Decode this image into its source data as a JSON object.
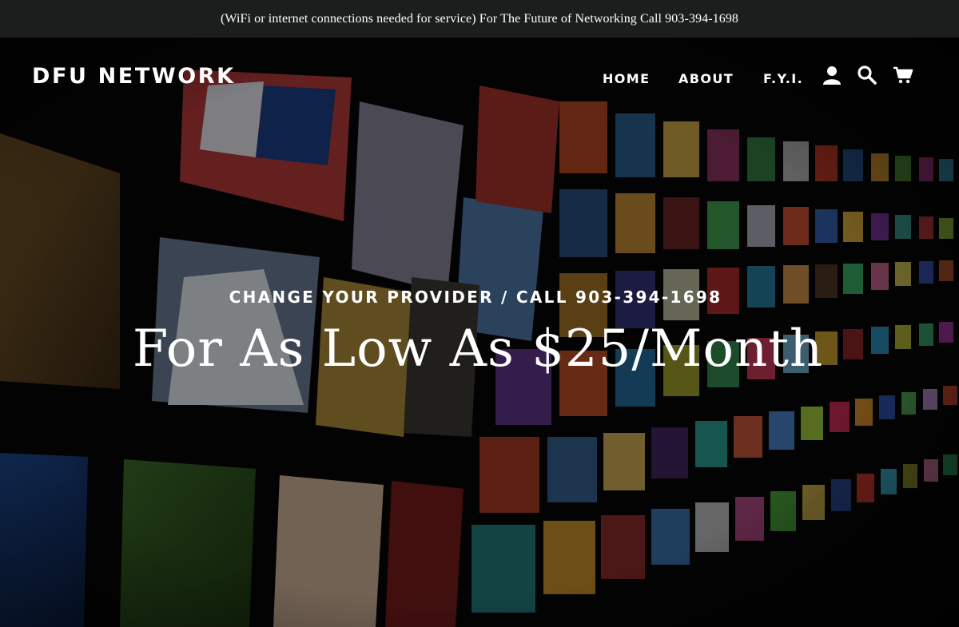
{
  "announcement": {
    "text": "(WiFi or internet connections needed for service) For The Future of Networking Call 903-394-1698"
  },
  "header": {
    "logo": "DFU NETWORK",
    "nav": [
      {
        "label": "HOME"
      },
      {
        "label": "ABOUT"
      },
      {
        "label": "F.Y.I."
      }
    ],
    "icons": {
      "account": "account-icon",
      "search": "search-icon",
      "cart": "cart-icon"
    }
  },
  "hero": {
    "subtitle": "CHANGE YOUR PROVIDER / CALL 903-394-1698",
    "title": "For As Low As $25/Month",
    "background": "video-wall-of-tv-screens"
  },
  "colors": {
    "announcement_bg": "#1c1d1d",
    "text": "#ffffff",
    "hero_overlay": "rgba(0,0,0,0.46)"
  }
}
